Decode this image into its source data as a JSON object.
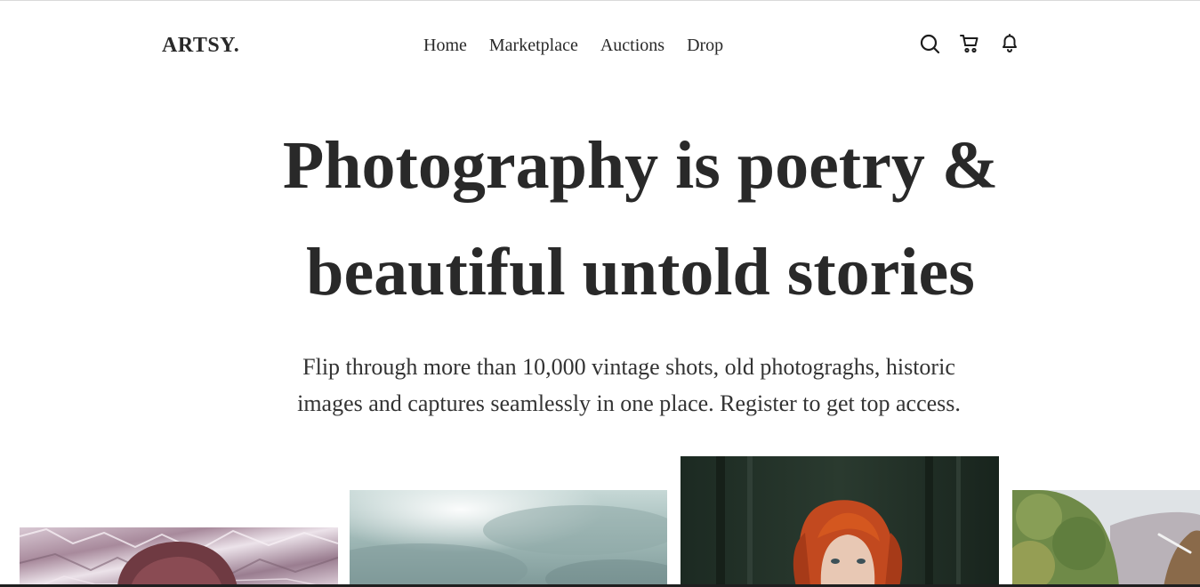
{
  "brand": {
    "logo": "ARTSY."
  },
  "nav": {
    "links": [
      "Home",
      "Marketplace",
      "Auctions",
      "Drop"
    ],
    "icons": [
      "search-icon",
      "cart-icon",
      "bell-icon"
    ]
  },
  "hero": {
    "title_line1": "Photography is poetry &",
    "title_line2": "beautiful untold stories",
    "subtitle_line1": "Flip through more than 10,000 vintage shots, old photograghs, historic",
    "subtitle_line2": "images and captures seamlessly in one place. Register to get top access."
  },
  "gallery": {
    "photos": [
      "portrait-foil",
      "cloudy-sky",
      "red-hair-woman-forest",
      "landscape-animal"
    ]
  },
  "colors": {
    "text": "#292929",
    "background": "#ffffff"
  }
}
